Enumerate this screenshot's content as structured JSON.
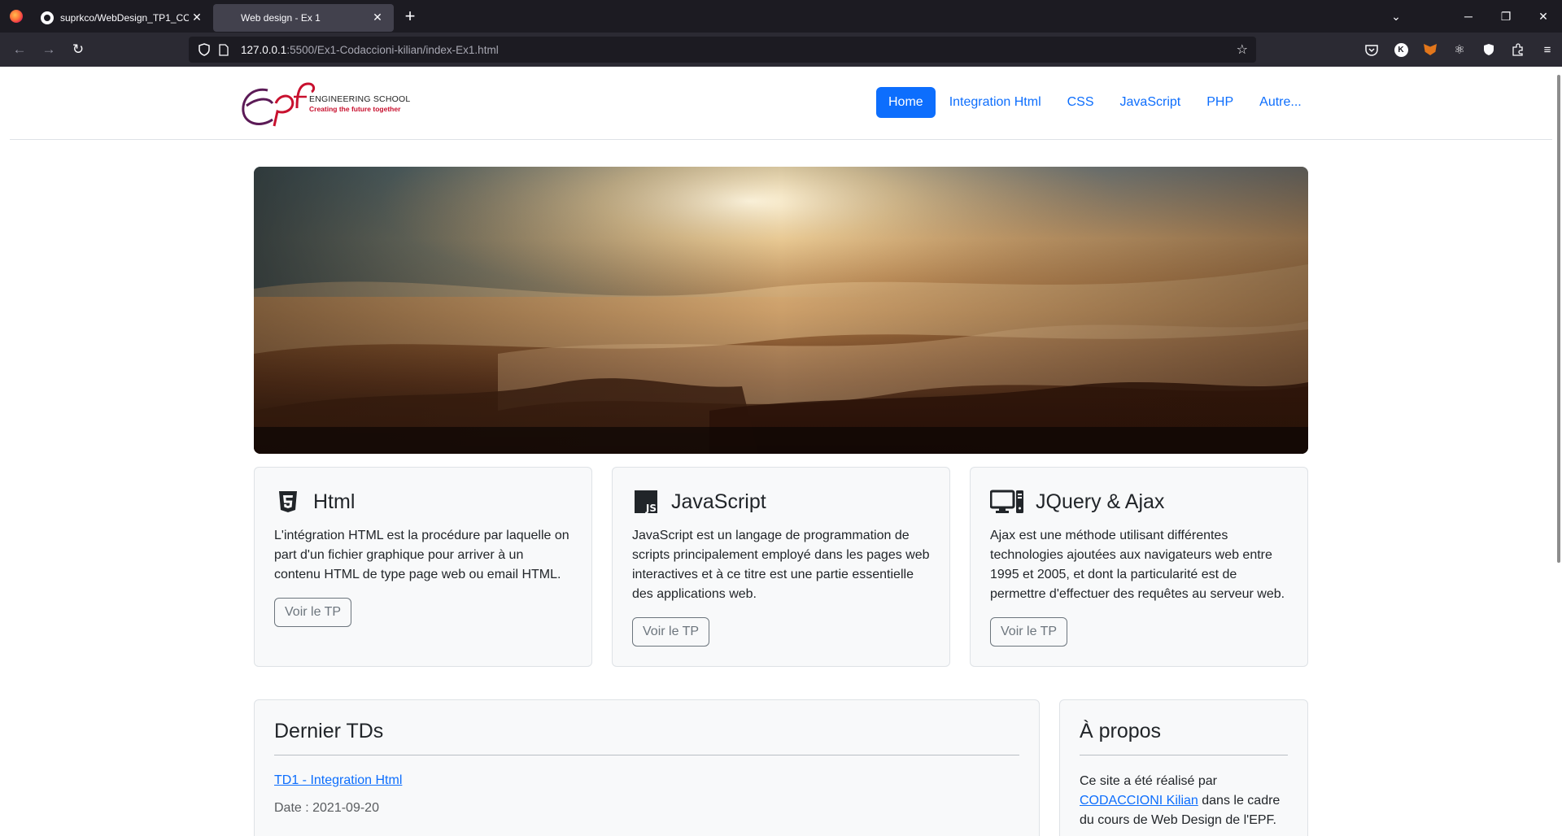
{
  "browser": {
    "tabs": [
      {
        "title": "suprkco/WebDesign_TP1_CODACCIONI",
        "active": false
      },
      {
        "title": "Web design - Ex 1",
        "active": true
      }
    ],
    "url_host": "127.0.0.1",
    "url_rest": ":5500/Ex1-Codaccioni-kilian/index-Ex1.html"
  },
  "logo": {
    "line1": "ENGINEERING SCHOOL",
    "line2": "Creating the future together"
  },
  "menu": {
    "home": "Home",
    "html": "Integration Html",
    "css": "CSS",
    "js": "JavaScript",
    "php": "PHP",
    "more": "Autre..."
  },
  "features": [
    {
      "icon": "html5-icon",
      "title": "Html",
      "text": "L'intégration HTML est la procédure par laquelle on part d'un fichier graphique pour arriver à un contenu HTML de type page web ou email HTML.",
      "button": "Voir le TP"
    },
    {
      "icon": "js-icon",
      "title": "JavaScript",
      "text": "JavaScript est un langage de programmation de scripts principalement employé dans les pages web interactives et à ce titre est une partie essentielle des applications web.",
      "button": "Voir le TP"
    },
    {
      "icon": "desktop-computer-icon",
      "title": "JQuery & Ajax",
      "text": "Ajax est une méthode utilisant différentes technologies ajoutées aux navigateurs web entre 1995 et 2005, et dont la particularité est de permettre d'effectuer des requêtes au serveur web.",
      "button": "Voir le TP"
    }
  ],
  "blog": {
    "title": "Dernier TDs",
    "link": "TD1 - Integration Html",
    "date": "Date : 2021-09-20"
  },
  "about": {
    "title": "À propos",
    "text_before": "Ce site a été réalisé par ",
    "author": "CODACCIONI Kilian",
    "text_after": " dans le cadre du cours de Web Design de l'EPF."
  },
  "colors": {
    "primary": "#0d6efd",
    "secondary": "#6c757d",
    "card_bg": "#f8f9fa",
    "logo_red": "#c8102e",
    "logo_purple": "#5b1a56"
  }
}
